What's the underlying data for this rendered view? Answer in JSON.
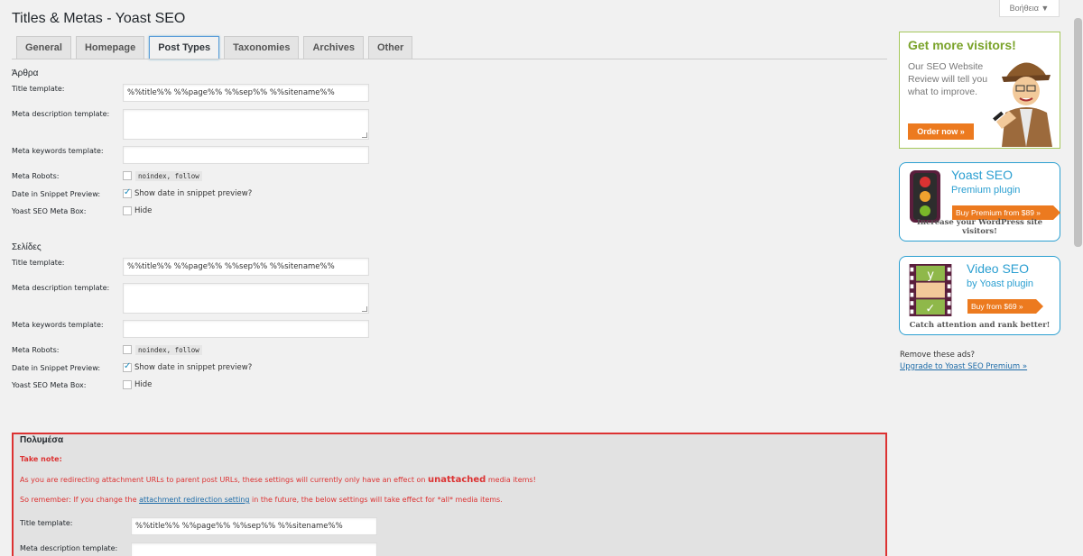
{
  "page": {
    "title": "Titles & Metas - Yoast SEO",
    "help": "Βοήθεια ▼"
  },
  "tabs": [
    {
      "label": "General"
    },
    {
      "label": "Homepage"
    },
    {
      "label": "Post Types",
      "active": true
    },
    {
      "label": "Taxonomies"
    },
    {
      "label": "Archives"
    },
    {
      "label": "Other"
    }
  ],
  "sections": [
    {
      "title": "Άρθρα",
      "title_template_label": "Title template:",
      "title_template_value": "%%title%% %%page%% %%sep%% %%sitename%%",
      "meta_desc_label": "Meta description template:",
      "meta_desc_value": "",
      "meta_keywords_label": "Meta keywords template:",
      "meta_keywords_value": "",
      "meta_robots_label": "Meta Robots:",
      "meta_robots_value": "noindex, follow",
      "date_label": "Date in Snippet Preview:",
      "date_cb_label": "Show date in snippet preview?",
      "metabox_label": "Yoast SEO Meta Box:",
      "metabox_cb_label": "Hide"
    },
    {
      "title": "Σελίδες",
      "title_template_label": "Title template:",
      "title_template_value": "%%title%% %%page%% %%sep%% %%sitename%%",
      "meta_desc_label": "Meta description template:",
      "meta_desc_value": "",
      "meta_keywords_label": "Meta keywords template:",
      "meta_keywords_value": "",
      "meta_robots_label": "Meta Robots:",
      "meta_robots_value": "noindex, follow",
      "date_label": "Date in Snippet Preview:",
      "date_cb_label": "Show date in snippet preview?",
      "metabox_label": "Yoast SEO Meta Box:",
      "metabox_cb_label": "Hide"
    }
  ],
  "media": {
    "title": "Πολυμέσα",
    "take_note": "Take note:",
    "line1_a": "As you are redirecting attachment URLs to parent post URLs, these settings will currently only have an effect on ",
    "line1_b": "unattached",
    "line1_c": " media items!",
    "line2_a": "So remember: If you change the ",
    "line2_link": "attachment redirection setting",
    "line2_b": " in the future, the below settings will take effect for *all* media items.",
    "title_template_label": "Title template:",
    "title_template_value": "%%title%% %%page%% %%sep%% %%sitename%%",
    "meta_desc_label": "Meta description template:",
    "meta_desc_value": ""
  },
  "ads": {
    "ad1": {
      "head": "Get more visitors!",
      "body": "Our SEO Website Review will tell you what to improve.",
      "button": "Order now »"
    },
    "ad2": {
      "title": "Yoast SEO",
      "subtitle": "Premium plugin",
      "button": "Buy Premium from $89 »",
      "tagline": "Increase your WordPress site visitors!"
    },
    "ad3": {
      "title": "Video SEO",
      "subtitle": "by Yoast plugin",
      "button": "Buy from $69 »",
      "tagline": "Catch attention and rank better!"
    },
    "remove": "Remove these ads?",
    "upgrade": "Upgrade to Yoast SEO Premium »"
  },
  "colors": {
    "accent": "#1e8cbe",
    "warning": "#dc3232",
    "orange": "#ec7a1f",
    "green": "#7aa32a"
  }
}
